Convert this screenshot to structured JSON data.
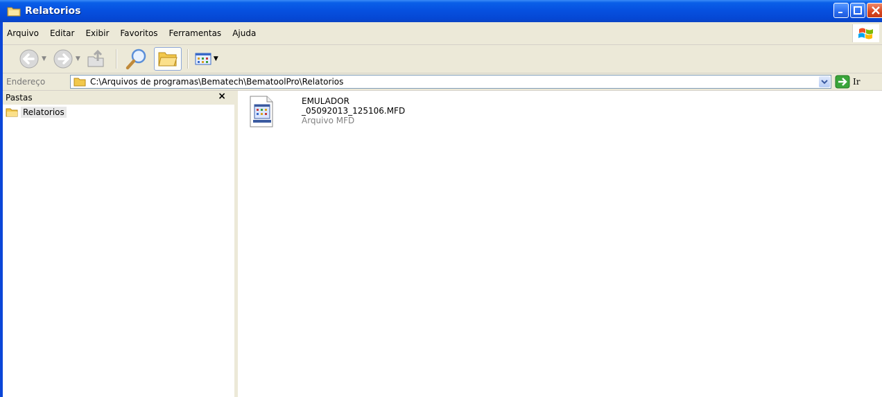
{
  "window": {
    "title": "Relatorios",
    "colors": {
      "titlebar": "#0651e0",
      "chrome": "#ece9d8",
      "close": "#d8451f"
    }
  },
  "menu": {
    "items": [
      "Arquivo",
      "Editar",
      "Exibir",
      "Favoritos",
      "Ferramentas",
      "Ajuda"
    ]
  },
  "toolbar": {
    "icons": [
      "back-icon",
      "forward-icon",
      "up-folder-icon",
      "search-icon",
      "folders-icon",
      "views-icon"
    ]
  },
  "address": {
    "label": "Endereço",
    "path": "C:\\Arquivos de programas\\Bematech\\BematoolPro\\Relatorios",
    "go_label": "Ir"
  },
  "folders_pane": {
    "title": "Pastas",
    "close": "×",
    "tree": [
      {
        "label": "Relatorios",
        "selected": true
      }
    ]
  },
  "files": [
    {
      "name_line1": "EMULADOR",
      "name_line2": "_05092013_125106.MFD",
      "type": "Arquivo MFD"
    }
  ]
}
